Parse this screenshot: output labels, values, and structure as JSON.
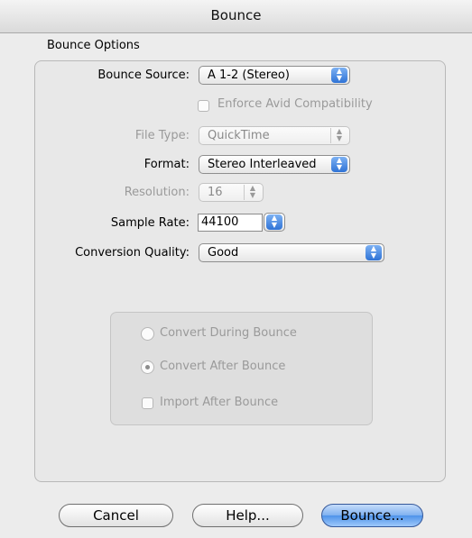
{
  "window": {
    "title": "Bounce"
  },
  "group": {
    "label": "Bounce Options"
  },
  "fields": {
    "bounce_source": {
      "label": "Bounce Source:",
      "value": "A 1-2 (Stereo)"
    },
    "enforce_avid": {
      "label": "Enforce Avid Compatibility",
      "checked": false
    },
    "file_type": {
      "label": "File Type:",
      "value": "QuickTime"
    },
    "format": {
      "label": "Format:",
      "value": "Stereo Interleaved"
    },
    "resolution": {
      "label": "Resolution:",
      "value": "16"
    },
    "sample_rate": {
      "label": "Sample Rate:",
      "value": "44100"
    },
    "conversion_quality": {
      "label": "Conversion Quality:",
      "value": "Good"
    }
  },
  "options": {
    "convert_during": {
      "label": "Convert During Bounce",
      "selected": false
    },
    "convert_after": {
      "label": "Convert After Bounce",
      "selected": true
    },
    "import_after": {
      "label": "Import After Bounce",
      "checked": false
    }
  },
  "buttons": {
    "cancel": "Cancel",
    "help": "Help...",
    "bounce": "Bounce..."
  },
  "icons": {
    "popup_arrows": "up-down-arrows-icon"
  }
}
